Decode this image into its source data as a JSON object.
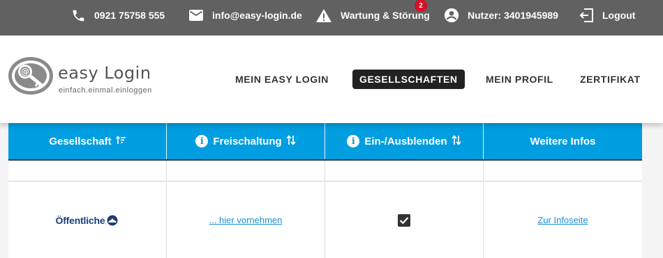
{
  "topbar": {
    "phone": {
      "icon": "phone-icon",
      "label": "0921 75758 555"
    },
    "email": {
      "icon": "mail-icon",
      "label": "info@easy-login.de"
    },
    "maintenance": {
      "icon": "warning-icon",
      "label": "Wartung & Störung",
      "badge": "2"
    },
    "user": {
      "icon": "account-circle-icon",
      "label": "Nutzer: 3401945989"
    },
    "logout": {
      "icon": "logout-icon",
      "label": "Logout"
    }
  },
  "logo": {
    "word": "easy Login",
    "tagline": "einfach.einmal.einloggen"
  },
  "nav": {
    "items": [
      {
        "label": "MEIN EASY LOGIN",
        "active": false
      },
      {
        "label": "GESELLSCHAFTEN",
        "active": true
      },
      {
        "label": "MEIN PROFIL",
        "active": false
      },
      {
        "label": "ZERTIFIKAT",
        "active": false
      }
    ]
  },
  "table": {
    "headers": [
      {
        "label": "Gesellschaft",
        "info": false,
        "sort": "sort-desc-icon"
      },
      {
        "label": "Freischaltung",
        "info": true,
        "sort": "sort-both-icon"
      },
      {
        "label": "Ein-/Ausblenden",
        "info": true,
        "sort": "sort-both-icon"
      },
      {
        "label": "Weitere Infos",
        "info": false,
        "sort": ""
      }
    ],
    "rows": [
      {
        "company": "Öffentliche",
        "activation_link": "... hier vornehmen",
        "visible": true,
        "info_link": "Zur Infoseite"
      }
    ]
  },
  "colors": {
    "topbar": "#616161",
    "table_header": "#009ee0",
    "active_nav": "#222222",
    "badge": "#d50f25",
    "link": "#1a8fd6",
    "company": "#1d3c7a"
  }
}
